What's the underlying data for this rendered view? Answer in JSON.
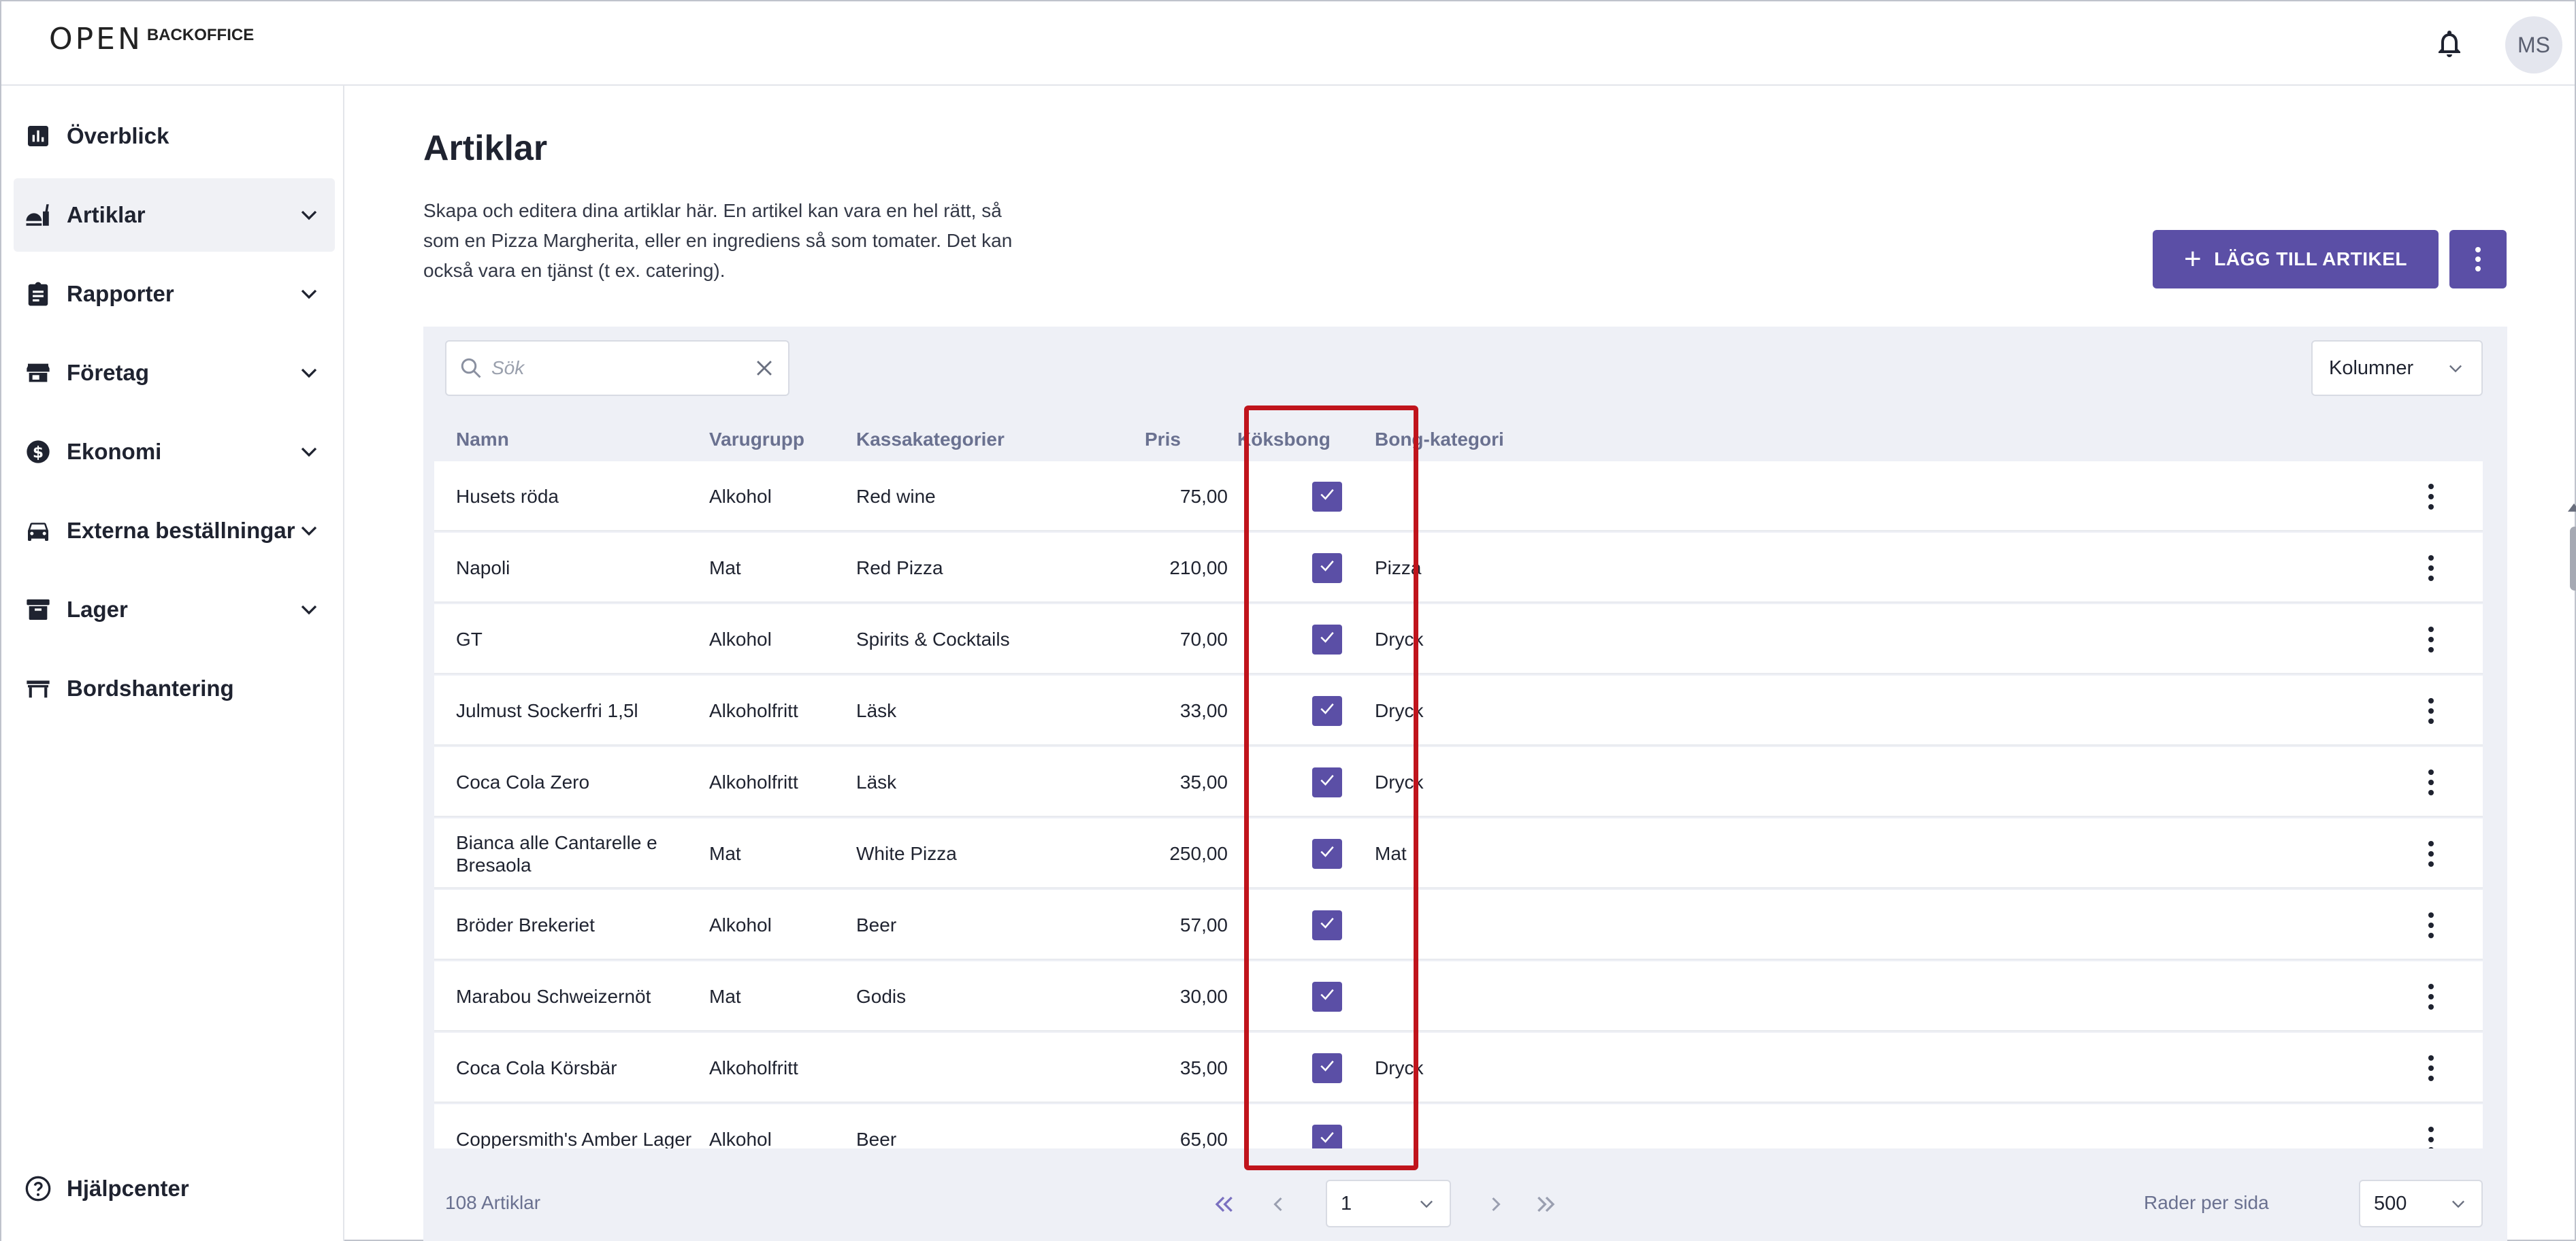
{
  "brand": {
    "logo_mark": "OPEN",
    "logo_text": "BACKOFFICE"
  },
  "user": {
    "initials": "MS"
  },
  "sidebar": {
    "items": [
      {
        "label": "Överblick",
        "icon": "chart-icon",
        "has_chevron": false,
        "active": false
      },
      {
        "label": "Artiklar",
        "icon": "food-icon",
        "has_chevron": true,
        "active": true
      },
      {
        "label": "Rapporter",
        "icon": "clipboard-icon",
        "has_chevron": true,
        "active": false
      },
      {
        "label": "Företag",
        "icon": "store-icon",
        "has_chevron": true,
        "active": false
      },
      {
        "label": "Ekonomi",
        "icon": "dollar-icon",
        "has_chevron": true,
        "active": false
      },
      {
        "label": "Externa beställningar",
        "icon": "car-icon",
        "has_chevron": true,
        "active": false
      },
      {
        "label": "Lager",
        "icon": "archive-icon",
        "has_chevron": true,
        "active": false
      },
      {
        "label": "Bordshantering",
        "icon": "table-icon",
        "has_chevron": false,
        "active": false
      }
    ],
    "help_label": "Hjälpcenter"
  },
  "page": {
    "title": "Artiklar",
    "description": "Skapa och editera dina artiklar här. En artikel kan vara en hel rätt, så som en Pizza Margherita, eller en ingrediens så som tomater. Det kan också vara en tjänst (t ex. catering).",
    "add_button_label": "LÄGG TILL ARTIKEL"
  },
  "search": {
    "placeholder": "Sök",
    "value": ""
  },
  "columns_button_label": "Kolumner",
  "table": {
    "headers": [
      "Namn",
      "Varugrupp",
      "Kassakategorier",
      "Pris",
      "Köksbong",
      "Bong-kategori"
    ],
    "rows": [
      {
        "name": "Husets röda",
        "group": "Alkohol",
        "category": "Red wine",
        "price": "75,00",
        "kitchen": true,
        "bong": ""
      },
      {
        "name": "Napoli",
        "group": "Mat",
        "category": "Red Pizza",
        "price": "210,00",
        "kitchen": true,
        "bong": "Pizza"
      },
      {
        "name": "GT",
        "group": "Alkohol",
        "category": "Spirits & Cocktails",
        "price": "70,00",
        "kitchen": true,
        "bong": "Dryck"
      },
      {
        "name": "Julmust Sockerfri 1,5l",
        "group": "Alkoholfritt",
        "category": "Läsk",
        "price": "33,00",
        "kitchen": true,
        "bong": "Dryck"
      },
      {
        "name": "Coca Cola Zero",
        "group": "Alkoholfritt",
        "category": "Läsk",
        "price": "35,00",
        "kitchen": true,
        "bong": "Dryck"
      },
      {
        "name": "Bianca alle Cantarelle e Bresaola",
        "group": "Mat",
        "category": "White Pizza",
        "price": "250,00",
        "kitchen": true,
        "bong": "Mat"
      },
      {
        "name": "Bröder Brekeriet",
        "group": "Alkohol",
        "category": "Beer",
        "price": "57,00",
        "kitchen": true,
        "bong": ""
      },
      {
        "name": "Marabou Schweizernöt",
        "group": "Mat",
        "category": "Godis",
        "price": "30,00",
        "kitchen": true,
        "bong": ""
      },
      {
        "name": "Coca Cola Körsbär",
        "group": "Alkoholfritt",
        "category": "",
        "price": "35,00",
        "kitchen": true,
        "bong": "Dryck"
      },
      {
        "name": "Coppersmith's Amber Lager",
        "group": "Alkohol",
        "category": "Beer",
        "price": "65,00",
        "kitchen": true,
        "bong": ""
      }
    ]
  },
  "footer": {
    "count_label": "108 Artiklar",
    "current_page": "1",
    "rows_per_page_label": "Rader per sida",
    "rows_per_page": "500"
  },
  "colors": {
    "accent": "#5b4fa6",
    "highlight": "#c0141c",
    "panel": "#eef0f6"
  }
}
